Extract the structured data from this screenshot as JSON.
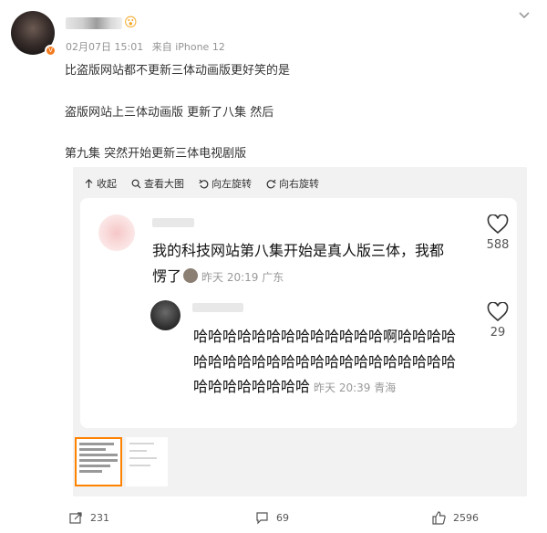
{
  "post": {
    "meta": {
      "date": "02月07日 15:01",
      "source": "来自 iPhone 12"
    },
    "user_emoji": "😮",
    "badge_glyph": "V",
    "text_lines": [
      "比盗版网站都不更新三体动画版更好笑的是",
      "盗版网站上三体动画版 更新了八集 然后",
      "第九集 突然开始更新三体电视剧版"
    ]
  },
  "media_toolbar": {
    "collapse": "收起",
    "view_large": "查看大图",
    "rotate_left": "向左旋转",
    "rotate_right": "向右旋转"
  },
  "screenshot": {
    "comment1": {
      "text": "我的科技网站第八集开始是真人版三体，我都愣了",
      "time_loc": "昨天 20:19 广东",
      "likes": "588"
    },
    "comment2": {
      "text": "哈哈哈哈哈哈哈哈哈哈哈哈哈啊哈哈哈哈哈哈哈哈哈哈哈哈哈哈哈哈哈哈哈哈哈哈哈哈哈哈哈哈哈哈",
      "time_loc": "昨天 20:39 青海",
      "likes": "29"
    }
  },
  "actions": {
    "repost_count": "231",
    "comment_count": "69",
    "like_count": "2596"
  },
  "colors": {
    "accent": "#ff8200",
    "badge": "#f47a1f",
    "meta_gray": "#939393"
  },
  "icons": [
    "more-icon",
    "collapse-icon",
    "search-icon",
    "rotate-left-icon",
    "rotate-right-icon",
    "heart-icon",
    "repost-icon",
    "comment-icon",
    "like-icon"
  ]
}
